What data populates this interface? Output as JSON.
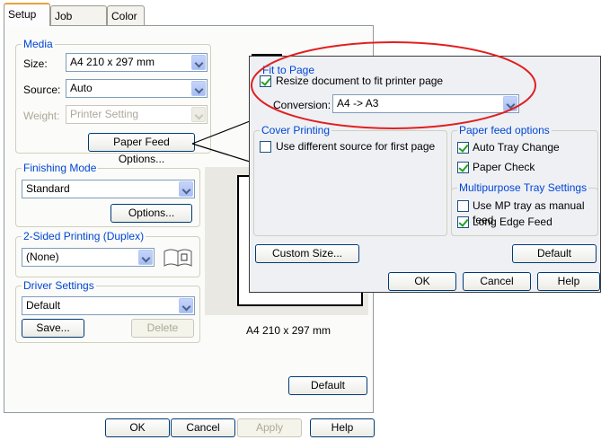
{
  "tabs": [
    {
      "label": "Setup"
    },
    {
      "label": "Job Options"
    },
    {
      "label": "Color"
    }
  ],
  "media": {
    "group_label": "Media",
    "size_label": "Size:",
    "size_value": "A4 210 x 297 mm",
    "source_label": "Source:",
    "source_value": "Auto",
    "weight_label": "Weight:",
    "weight_value": "Printer Setting",
    "paper_feed_button": "Paper Feed Options..."
  },
  "finishing": {
    "group_label": "Finishing Mode",
    "value": "Standard",
    "options_button": "Options..."
  },
  "duplex": {
    "group_label": "2-Sided Printing (Duplex)",
    "value": "(None)"
  },
  "driver": {
    "group_label": "Driver Settings",
    "value": "Default",
    "save_button": "Save...",
    "delete_button": "Delete"
  },
  "preview": {
    "caption": "A4 210 x 297 mm"
  },
  "main_buttons": {
    "default": "Default",
    "ok": "OK",
    "cancel": "Cancel",
    "apply": "Apply",
    "help": "Help"
  },
  "overlay": {
    "fit_group_label": "Fit to Page",
    "resize_label": "Resize document to fit printer page",
    "resize_checked": true,
    "conversion_label": "Conversion:",
    "conversion_value": "A4 -> A3",
    "cover_group_label": "Cover Printing",
    "cover_label": "Use different source for first page",
    "cover_checked": false,
    "paper_feed_group_label": "Paper feed options",
    "auto_tray_label": "Auto Tray Change",
    "auto_tray_checked": true,
    "paper_check_label": "Paper Check",
    "paper_check_checked": true,
    "mp_group_label": "Multipurpose Tray Settings",
    "mp_manual_label": "Use MP tray as manual feed",
    "mp_manual_checked": false,
    "long_edge_label": "Long Edge Feed",
    "long_edge_checked": true,
    "custom_size_button": "Custom Size...",
    "default_button": "Default",
    "ok_button": "OK",
    "cancel_button": "Cancel",
    "help_button": "Help"
  },
  "colors": {
    "group_label": "#0046d5",
    "highlight_ellipse": "#e02020",
    "active_tab_accent": "#e8a33c"
  }
}
